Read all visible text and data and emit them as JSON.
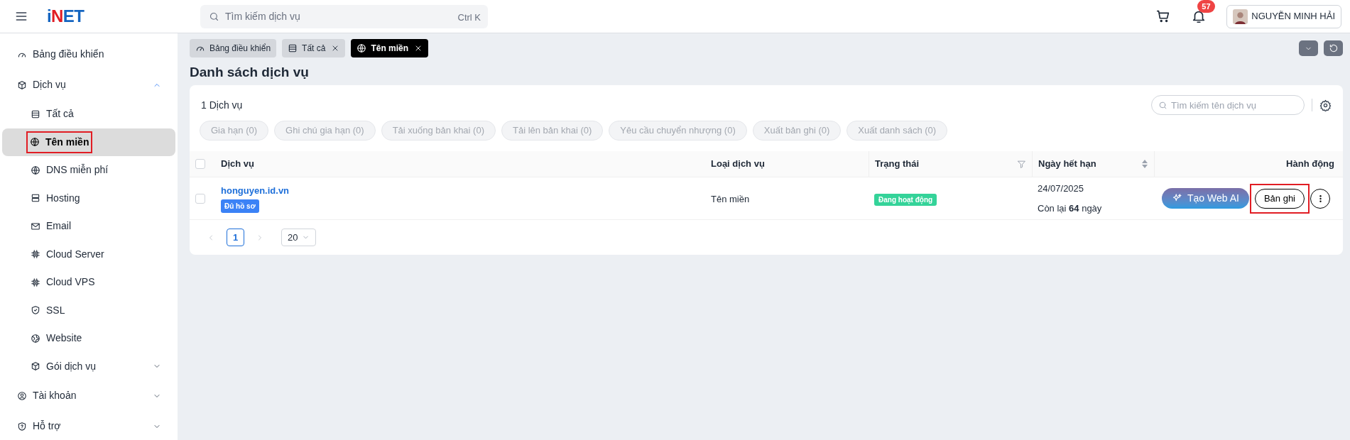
{
  "header": {
    "logo": "iNET",
    "search": {
      "placeholder": "Tìm kiếm dịch vụ",
      "shortcut": "Ctrl K"
    },
    "notifications": "57",
    "user": "NGUYỄN MINH HẢI"
  },
  "sidebar": {
    "items": [
      {
        "label": "Bảng điều khiển",
        "selected": false,
        "highlighted": false
      },
      {
        "label": "Dịch vụ",
        "selected": false,
        "highlighted": false,
        "expanded": true,
        "children": [
          {
            "label": "Tất cả",
            "selected": false,
            "highlighted": false
          },
          {
            "label": "Tên miền",
            "selected": true,
            "highlighted": true
          },
          {
            "label": "DNS miễn phí",
            "selected": false,
            "highlighted": false
          },
          {
            "label": "Hosting",
            "selected": false,
            "highlighted": false
          },
          {
            "label": "Email",
            "selected": false,
            "highlighted": false
          },
          {
            "label": "Cloud Server",
            "selected": false,
            "highlighted": false
          },
          {
            "label": "Cloud VPS",
            "selected": false,
            "highlighted": false
          },
          {
            "label": "SSL",
            "selected": false,
            "highlighted": false
          },
          {
            "label": "Website",
            "selected": false,
            "highlighted": false
          },
          {
            "label": "Gói dịch vụ",
            "selected": false,
            "highlighted": false,
            "expanded": false
          }
        ]
      },
      {
        "label": "Tài khoản",
        "selected": false,
        "highlighted": false,
        "expanded": false
      },
      {
        "label": "Hỗ trợ",
        "selected": false,
        "highlighted": false,
        "expanded": false
      }
    ]
  },
  "tabs": [
    {
      "label": "Bảng điều khiển",
      "selected": false,
      "closable": false
    },
    {
      "label": "Tất cả",
      "selected": false,
      "closable": true
    },
    {
      "label": "Tên miền",
      "selected": true,
      "closable": true
    }
  ],
  "page_title": "Danh sách dịch vụ",
  "toolbar": {
    "count": "1 Dịch vụ",
    "search_placeholder": "Tìm kiếm tên dịch vụ",
    "bulk_actions": [
      {
        "label": "Gia hạn (0)",
        "disabled": true
      },
      {
        "label": "Ghi chú gia hạn (0)",
        "disabled": true
      },
      {
        "label": "Tải xuống bản khai (0)",
        "disabled": true
      },
      {
        "label": "Tải lên bản khai (0)",
        "disabled": true
      },
      {
        "label": "Yêu cầu chuyển nhượng (0)",
        "disabled": true
      },
      {
        "label": "Xuất bản ghi (0)",
        "disabled": true
      },
      {
        "label": "Xuất danh sách (0)",
        "disabled": true
      }
    ]
  },
  "table": {
    "select_all_checked": false,
    "columns": [
      {
        "label": "Dịch vụ",
        "kind": "plain"
      },
      {
        "label": "Loại dịch vụ",
        "kind": "plain"
      },
      {
        "label": "Trạng thái",
        "kind": "filter"
      },
      {
        "label": "Ngày hết hạn",
        "kind": "sort"
      },
      {
        "label": "Hành động",
        "kind": "right"
      }
    ],
    "rows": [
      {
        "checked": false,
        "service": "honguyen.id.vn",
        "tag": "Đủ hồ sơ",
        "type": "Tên miền",
        "status": {
          "label": "Đang hoạt động",
          "color": "#34d399"
        },
        "expiry": "24/07/2025",
        "remaining": "Còn lại **64** ngày",
        "actions": [
          {
            "label": "Tạo Web AI",
            "kind": "ai",
            "highlighted": false
          },
          {
            "label": "Bản ghi",
            "kind": "outline",
            "highlighted": true
          },
          {
            "kind": "more",
            "highlighted": false
          }
        ]
      }
    ]
  },
  "pagination": {
    "pages": [
      {
        "label": "1",
        "selected": true
      }
    ],
    "page_size": "20"
  }
}
